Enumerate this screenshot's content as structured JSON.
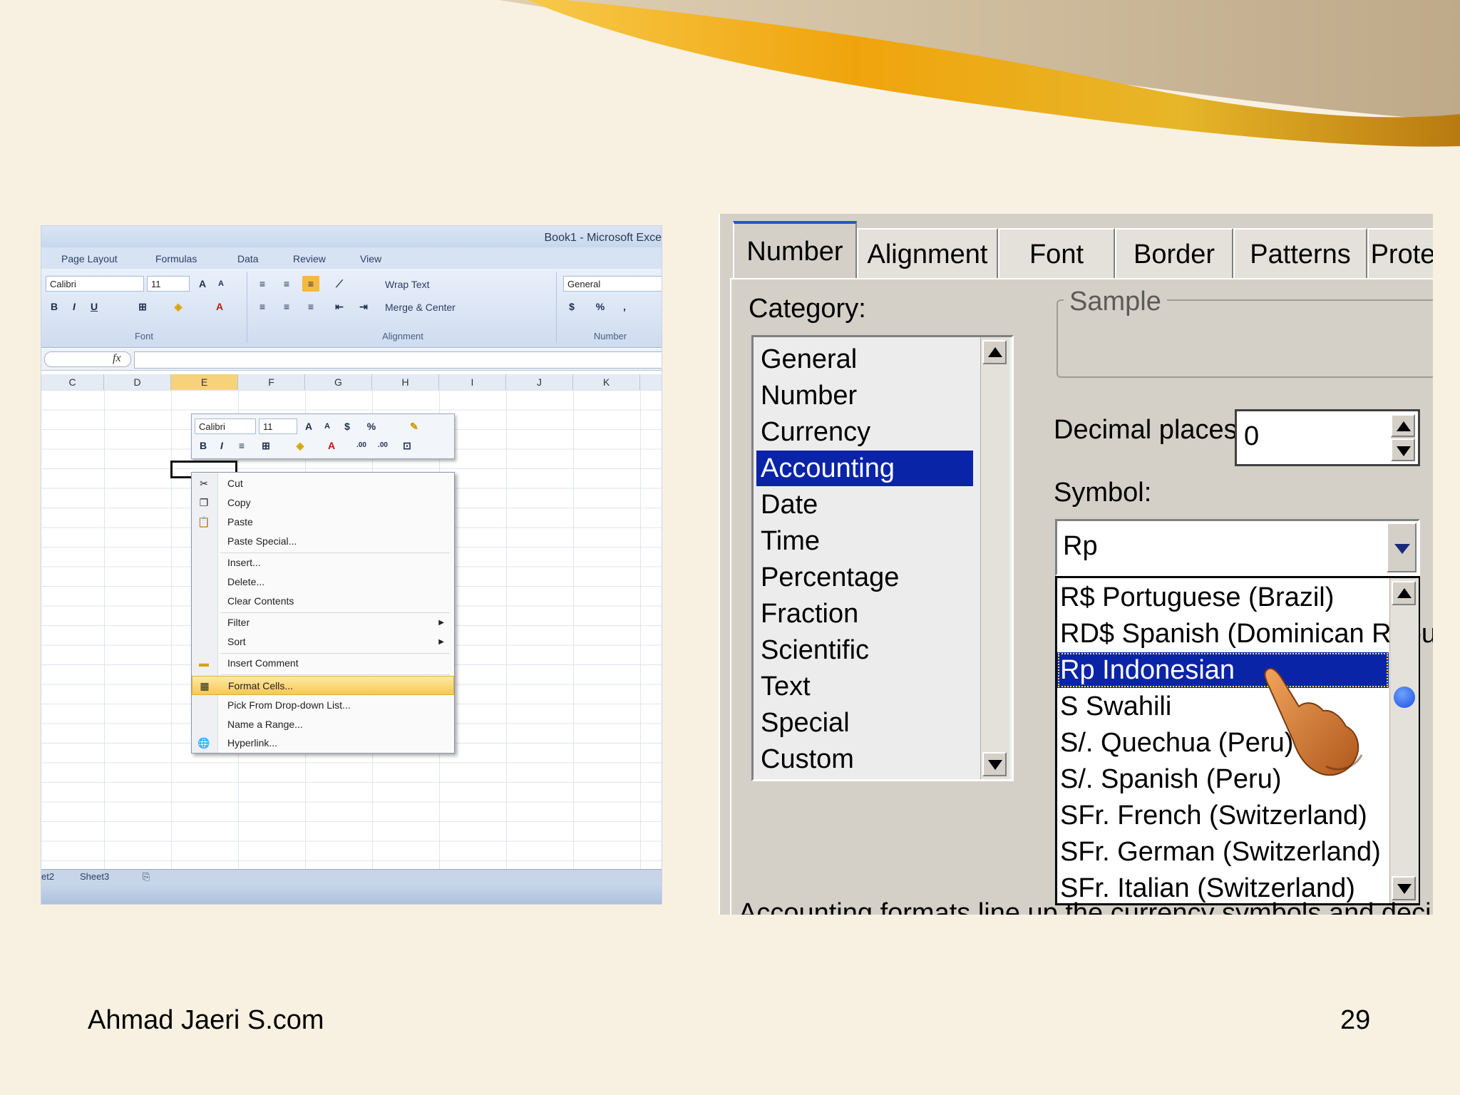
{
  "excel": {
    "window_title": "Book1 - Microsoft Exce",
    "ribbon_tabs": [
      "Page Layout",
      "Formulas",
      "Data",
      "Review",
      "View"
    ],
    "font_group": {
      "font_name": "Calibri",
      "font_size": "11",
      "label": "Font"
    },
    "alignment_group": {
      "wrap_text": "Wrap Text",
      "merge_center": "Merge & Center",
      "label": "Alignment"
    },
    "number_group": {
      "format": "General",
      "currency": "$",
      "percent": "%",
      "comma": ",",
      "label": "Number"
    },
    "formula_fx": "fx",
    "columns": [
      "C",
      "D",
      "E",
      "F",
      "G",
      "H",
      "I",
      "J",
      "K"
    ],
    "selected_column": "E",
    "mini_toolbar": {
      "font_name": "Calibri",
      "font_size": "11",
      "bold": "B",
      "italic": "I",
      "currency": "$",
      "percent": "%"
    },
    "context_menu": [
      {
        "label": "Cut",
        "icon": "scissors-icon"
      },
      {
        "label": "Copy",
        "icon": "copy-icon"
      },
      {
        "label": "Paste",
        "icon": "paste-icon"
      },
      {
        "label": "Paste Special..."
      },
      {
        "label": "Insert..."
      },
      {
        "label": "Delete..."
      },
      {
        "label": "Clear Contents"
      },
      {
        "label": "Filter",
        "submenu": true
      },
      {
        "label": "Sort",
        "submenu": true
      },
      {
        "label": "Insert Comment",
        "icon": "comment-icon"
      },
      {
        "label": "Format Cells...",
        "icon": "format-cells-icon",
        "highlighted": true
      },
      {
        "label": "Pick From Drop-down List..."
      },
      {
        "label": "Name a Range..."
      },
      {
        "label": "Hyperlink...",
        "icon": "hyperlink-icon"
      }
    ],
    "sheet_tabs": [
      "et2",
      "Sheet3"
    ]
  },
  "dialog": {
    "tabs": [
      "Number",
      "Alignment",
      "Font",
      "Border",
      "Patterns",
      "Prote"
    ],
    "active_tab": "Number",
    "category_label": "Category:",
    "categories": [
      "General",
      "Number",
      "Currency",
      "Accounting",
      "Date",
      "Time",
      "Percentage",
      "Fraction",
      "Scientific",
      "Text",
      "Special",
      "Custom"
    ],
    "selected_category": "Accounting",
    "sample_label": "Sample",
    "decimal_label": "Decimal places:",
    "decimal_value": "0",
    "symbol_label": "Symbol:",
    "symbol_value": "Rp",
    "symbols": [
      "R$  Portuguese (Brazil)",
      "RD$ Spanish (Dominican Repub",
      "Rp Indonesian",
      "S Swahili",
      "S/. Quechua (Peru)",
      "S/. Spanish (Peru)",
      "SFr. French (Switzerland)",
      "SFr. German (Switzerland)",
      "SFr. Italian (Switzerland)"
    ],
    "selected_symbol": "Rp Indonesian",
    "footnote": "Accounting formats line up the currency symbols and decimal poin"
  },
  "footer": {
    "left": "Ahmad Jaeri S.com",
    "right": "29"
  },
  "colors": {
    "slide_bg": "#f8f1e2",
    "selection_blue": "#0a24a8",
    "dialog_gray": "#d4d0c8",
    "menu_highlight": "#f8c94d"
  }
}
